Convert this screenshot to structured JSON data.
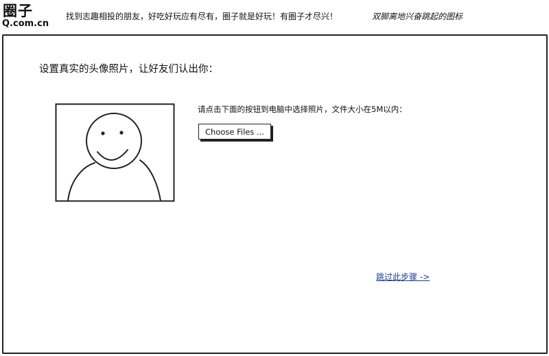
{
  "header": {
    "logo_main": "圈子",
    "logo_sub": "Q.com.cn",
    "slogan": "找到志趣相投的朋友，好吃好玩应有尽有，圈子就是好玩！有圈子才尽兴！",
    "note": "双脚离地兴奋跳起的图标"
  },
  "main": {
    "heading": "设置真实的头像照片，让好友们认出你：",
    "avatar_icon": "smiley-face-avatar-icon",
    "instructions": "请点击下面的按钮到电脑中选择照片，文件大小在5M以内：",
    "choose_files_label": "Choose Files ...",
    "skip_link": "跳过此步骤 ->"
  }
}
